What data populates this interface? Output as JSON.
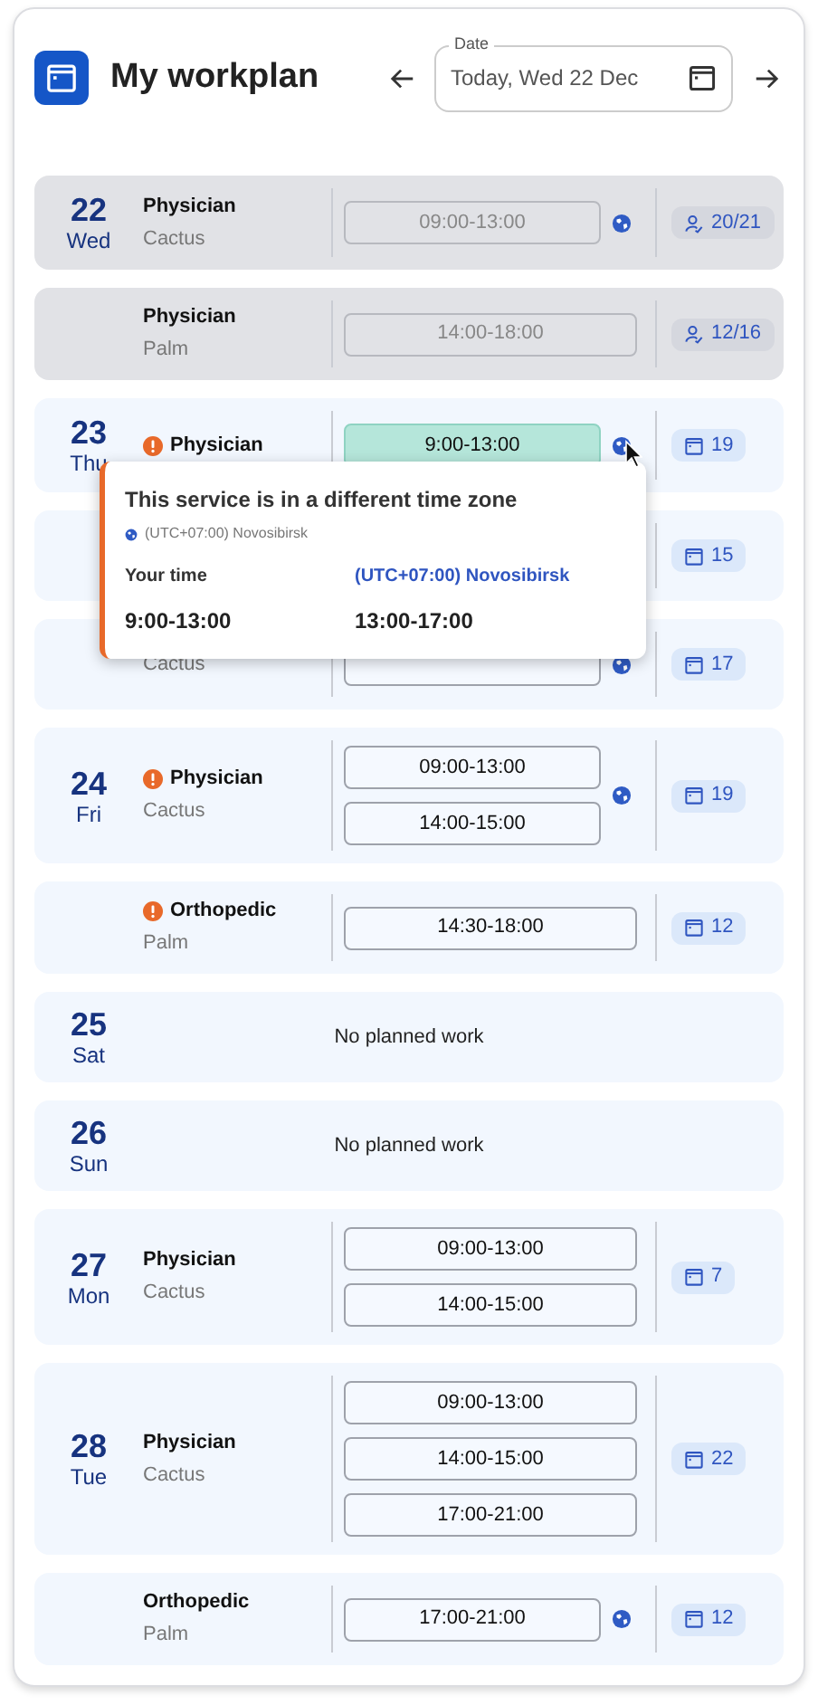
{
  "header": {
    "title": "My workplan",
    "date_field": {
      "label": "Date",
      "value": "Today, Wed 22 Dec"
    }
  },
  "entries": [
    {
      "kind": "shift",
      "past": true,
      "day": "22",
      "weekday": "Wed",
      "title": "Physician",
      "subtitle": "Cactus",
      "warning": false,
      "slots": [
        {
          "time": "09:00-13:00",
          "selected": false
        }
      ],
      "globe": true,
      "badge": {
        "kind": "capacity",
        "text": "20/21"
      }
    },
    {
      "kind": "shift",
      "past": true,
      "title": "Physician",
      "subtitle": "Palm",
      "warning": false,
      "slots": [
        {
          "time": "14:00-18:00",
          "selected": false
        }
      ],
      "globe": false,
      "badge": {
        "kind": "capacity",
        "text": "12/16"
      }
    },
    {
      "kind": "shift",
      "past": false,
      "day": "23",
      "weekday": "Thu",
      "title": "Physician",
      "warning": true,
      "slots": [
        {
          "time": "9:00-13:00",
          "selected": true
        }
      ],
      "globe": true,
      "badge": {
        "kind": "calendar",
        "text": "19"
      }
    },
    {
      "kind": "shift",
      "past": false,
      "globe": false,
      "badge": {
        "kind": "calendar",
        "text": "15"
      }
    },
    {
      "kind": "shift",
      "past": false,
      "subtitle": "Cactus",
      "slots": [
        {
          "selected": false
        }
      ],
      "globe": true,
      "badge": {
        "kind": "calendar",
        "text": "17"
      }
    },
    {
      "kind": "shift",
      "past": false,
      "day": "24",
      "weekday": "Fri",
      "title": "Physician",
      "subtitle": "Cactus",
      "warning": true,
      "slots": [
        {
          "time": "09:00-13:00",
          "selected": false
        },
        {
          "time": "14:00-15:00",
          "selected": false
        }
      ],
      "globe": true,
      "badge": {
        "kind": "calendar",
        "text": "19"
      }
    },
    {
      "kind": "shift",
      "past": false,
      "title": "Orthopedic",
      "subtitle": "Palm",
      "warning": true,
      "slots": [
        {
          "time": "14:30-18:00",
          "selected": false
        }
      ],
      "globe": false,
      "badge": {
        "kind": "calendar",
        "text": "12"
      }
    },
    {
      "kind": "empty",
      "day": "25",
      "weekday": "Sat",
      "message": "No planned work"
    },
    {
      "kind": "empty",
      "day": "26",
      "weekday": "Sun",
      "message": "No planned work"
    },
    {
      "kind": "shift",
      "past": false,
      "day": "27",
      "weekday": "Mon",
      "title": "Physician",
      "subtitle": "Cactus",
      "warning": false,
      "slots": [
        {
          "time": "09:00-13:00",
          "selected": false
        },
        {
          "time": "14:00-15:00",
          "selected": false
        }
      ],
      "globe": false,
      "badge": {
        "kind": "calendar",
        "text": "7"
      }
    },
    {
      "kind": "shift",
      "past": false,
      "day": "28",
      "weekday": "Tue",
      "title": "Physician",
      "subtitle": "Cactus",
      "warning": false,
      "slots": [
        {
          "time": "09:00-13:00",
          "selected": false
        },
        {
          "time": "14:00-15:00",
          "selected": false
        },
        {
          "time": "17:00-21:00",
          "selected": false
        }
      ],
      "globe": false,
      "badge": {
        "kind": "calendar",
        "text": "22"
      }
    },
    {
      "kind": "shift",
      "past": false,
      "title": "Orthopedic",
      "subtitle": "Palm",
      "warning": false,
      "slots": [
        {
          "time": "17:00-21:00",
          "selected": false
        }
      ],
      "globe": true,
      "badge": {
        "kind": "calendar",
        "text": "12"
      }
    }
  ],
  "tooltip": {
    "title": "This service is in a different time zone",
    "zone": "(UTC+07:00) Novosibirsk",
    "columns": [
      {
        "heading": "Your time",
        "time": "9:00-13:00",
        "kind": "local"
      },
      {
        "heading": "(UTC+07:00) Novosibirsk",
        "time": "13:00-17:00",
        "kind": "remote"
      }
    ]
  }
}
